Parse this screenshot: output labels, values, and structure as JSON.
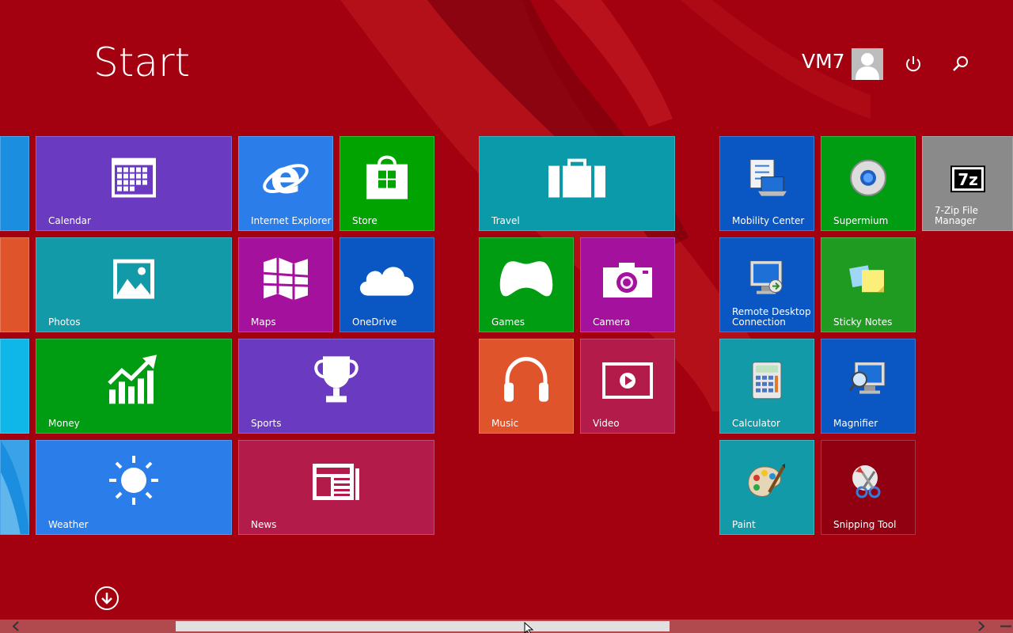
{
  "header": {
    "title": "Start",
    "user_name": "VM7"
  },
  "icons": {
    "avatar": "user-avatar-icon",
    "power": "power-icon",
    "search": "search-icon",
    "scroll_down": "arrow-down-circle-icon"
  },
  "tiles": {
    "calendar": {
      "label": "Calendar",
      "color": "#6a3ac1"
    },
    "internet_explorer": {
      "label": "Internet Explorer",
      "color": "#2b7de9"
    },
    "store": {
      "label": "Store",
      "color": "#00a300"
    },
    "photos": {
      "label": "Photos",
      "color": "#139aa8"
    },
    "maps": {
      "label": "Maps",
      "color": "#a4119d"
    },
    "onedrive": {
      "label": "OneDrive",
      "color": "#0a56c2"
    },
    "money": {
      "label": "Money",
      "color": "#009c12"
    },
    "sports": {
      "label": "Sports",
      "color": "#6a3ac1"
    },
    "weather": {
      "label": "Weather",
      "color": "#2b7de9"
    },
    "news": {
      "label": "News",
      "color": "#b31b4b"
    },
    "travel": {
      "label": "Travel",
      "color": "#0b9aaa"
    },
    "games": {
      "label": "Games",
      "color": "#009c12"
    },
    "camera": {
      "label": "Camera",
      "color": "#a4119d"
    },
    "music": {
      "label": "Music",
      "color": "#e0542b"
    },
    "video": {
      "label": "Video",
      "color": "#b31b4b"
    },
    "mobility_center": {
      "label": "Mobility Center",
      "color": "#0a56c2"
    },
    "supermium": {
      "label": "Supermium",
      "color": "#009c12"
    },
    "seven_zip": {
      "label": "7-Zip File\nManager",
      "color": "#8a8a8a"
    },
    "remote_desktop": {
      "label": "Remote Desktop\nConnection",
      "color": "#0a56c2"
    },
    "sticky_notes": {
      "label": "Sticky Notes",
      "color": "#1f9b22"
    },
    "calculator": {
      "label": "Calculator",
      "color": "#139aa8"
    },
    "magnifier": {
      "label": "Magnifier",
      "color": "#0a56c2"
    },
    "paint": {
      "label": "Paint",
      "color": "#139aa8"
    },
    "snipping_tool": {
      "label": "Snipping Tool",
      "color": "#900010"
    },
    "seven_zip_glyph": "7z"
  },
  "partial_tiles_colors": [
    "#1b8ee0",
    "#e0542b",
    "#0fb6e8",
    "#1b8ee0"
  ],
  "scrollbar": {
    "position_fraction": 0.16,
    "visible_fraction": 0.52
  },
  "colors": {
    "background": "#a30010"
  }
}
